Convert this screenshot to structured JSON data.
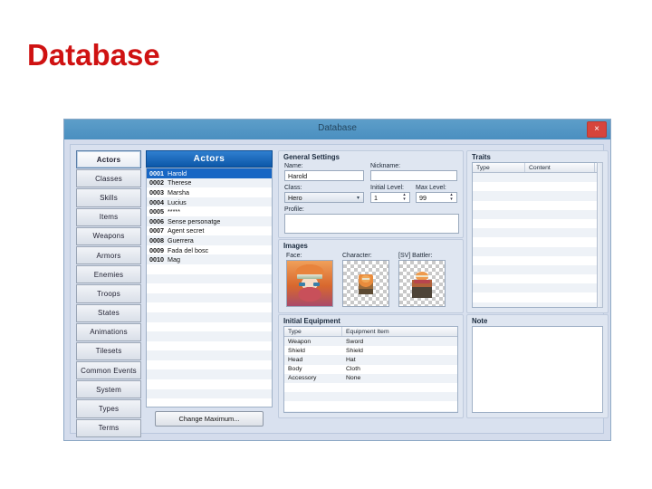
{
  "slide": {
    "title": "Database"
  },
  "window": {
    "titlebar_text": "Database",
    "close_label": "×"
  },
  "tabs": [
    {
      "label": "Actors",
      "selected": true
    },
    {
      "label": "Classes",
      "selected": false
    },
    {
      "label": "Skills",
      "selected": false
    },
    {
      "label": "Items",
      "selected": false
    },
    {
      "label": "Weapons",
      "selected": false
    },
    {
      "label": "Armors",
      "selected": false
    },
    {
      "label": "Enemies",
      "selected": false
    },
    {
      "label": "Troops",
      "selected": false
    },
    {
      "label": "States",
      "selected": false
    },
    {
      "label": "Animations",
      "selected": false
    },
    {
      "label": "Tilesets",
      "selected": false
    },
    {
      "label": "Common Events",
      "selected": false
    },
    {
      "label": "System",
      "selected": false
    },
    {
      "label": "Types",
      "selected": false
    },
    {
      "label": "Terms",
      "selected": false
    }
  ],
  "list_panel": {
    "header": "Actors",
    "items": [
      {
        "index": "0001",
        "name": "Harold",
        "selected": true
      },
      {
        "index": "0002",
        "name": "Therese",
        "selected": false
      },
      {
        "index": "0003",
        "name": "Marsha",
        "selected": false
      },
      {
        "index": "0004",
        "name": "Lucius",
        "selected": false
      },
      {
        "index": "0005",
        "name": "*****",
        "selected": false
      },
      {
        "index": "0006",
        "name": "Sense personatge",
        "selected": false
      },
      {
        "index": "0007",
        "name": "Agent secret",
        "selected": false
      },
      {
        "index": "0008",
        "name": "Guerrera",
        "selected": false
      },
      {
        "index": "0009",
        "name": "Fada del bosc",
        "selected": false
      },
      {
        "index": "0010",
        "name": "Mag",
        "selected": false
      }
    ],
    "change_maximum_label": "Change Maximum..."
  },
  "general_settings": {
    "title": "General Settings",
    "name_label": "Name:",
    "name_value": "Harold",
    "nickname_label": "Nickname:",
    "nickname_value": "",
    "class_label": "Class:",
    "class_value": "Hero",
    "initial_level_label": "Initial Level:",
    "initial_level_value": "1",
    "max_level_label": "Max Level:",
    "max_level_value": "99",
    "profile_label": "Profile:",
    "profile_value": ""
  },
  "images": {
    "title": "Images",
    "face_label": "Face:",
    "character_label": "Character:",
    "battler_label": "[SV] Battler:"
  },
  "initial_equipment": {
    "title": "Initial Equipment",
    "columns": [
      "Type",
      "Equipment Item"
    ],
    "rows": [
      {
        "type": "Weapon",
        "item": "Sword"
      },
      {
        "type": "Shield",
        "item": "Shield"
      },
      {
        "type": "Head",
        "item": "Hat"
      },
      {
        "type": "Body",
        "item": "Cloth"
      },
      {
        "type": "Accessory",
        "item": "None"
      }
    ]
  },
  "traits": {
    "title": "Traits",
    "columns": [
      "Type",
      "Content"
    ],
    "rows": []
  },
  "note": {
    "title": "Note",
    "value": ""
  },
  "colors": {
    "title_red": "#cf1212",
    "titlebar_blue": "#5d9ec9",
    "list_header_blue": "#0c57a8",
    "selection_blue": "#1766c4",
    "close_red": "#d6453c",
    "panel_bg": "#dfe6f1"
  }
}
